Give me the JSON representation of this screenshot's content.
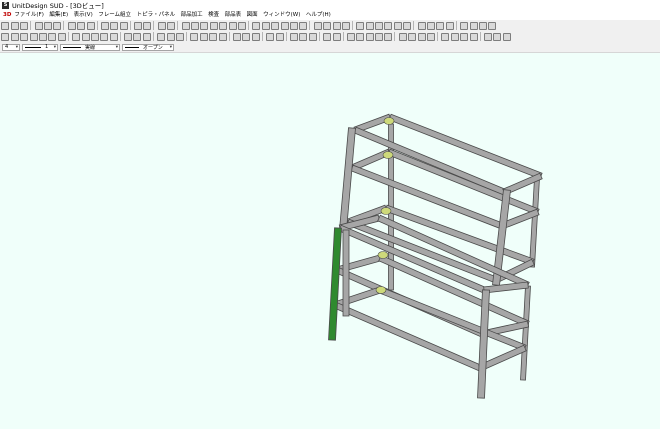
{
  "window": {
    "title": "UnitDesign SUD - [3Dビュー]"
  },
  "menu": {
    "items": [
      "ファイル(F)",
      "編集(E)",
      "表示(V)",
      "フレーム組立",
      "トピラ・パネル",
      "部品加工",
      "検査",
      "部品表",
      "図面",
      "ウィンドウ(W)",
      "ヘルプ(H)"
    ]
  },
  "propbar": {
    "color_value": "4",
    "line_weight_value": "1",
    "line_style_label": "実線",
    "end_style_label": "オープン"
  },
  "colors": {
    "canvas_background": "#f0fffa",
    "frame_fill": "#a6a6a6",
    "frame_stroke": "#4a4a4a",
    "bracket": "#cdd97a",
    "highlight_post": "#2f8a2f"
  }
}
